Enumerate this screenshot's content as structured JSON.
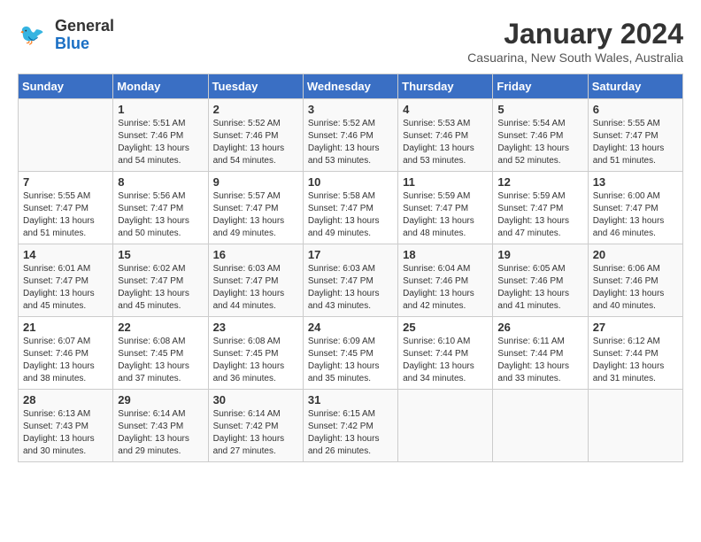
{
  "header": {
    "logo_line1": "General",
    "logo_line2": "Blue",
    "title": "January 2024",
    "subtitle": "Casuarina, New South Wales, Australia"
  },
  "weekdays": [
    "Sunday",
    "Monday",
    "Tuesday",
    "Wednesday",
    "Thursday",
    "Friday",
    "Saturday"
  ],
  "weeks": [
    [
      {
        "day": "",
        "info": ""
      },
      {
        "day": "1",
        "info": "Sunrise: 5:51 AM\nSunset: 7:46 PM\nDaylight: 13 hours\nand 54 minutes."
      },
      {
        "day": "2",
        "info": "Sunrise: 5:52 AM\nSunset: 7:46 PM\nDaylight: 13 hours\nand 54 minutes."
      },
      {
        "day": "3",
        "info": "Sunrise: 5:52 AM\nSunset: 7:46 PM\nDaylight: 13 hours\nand 53 minutes."
      },
      {
        "day": "4",
        "info": "Sunrise: 5:53 AM\nSunset: 7:46 PM\nDaylight: 13 hours\nand 53 minutes."
      },
      {
        "day": "5",
        "info": "Sunrise: 5:54 AM\nSunset: 7:46 PM\nDaylight: 13 hours\nand 52 minutes."
      },
      {
        "day": "6",
        "info": "Sunrise: 5:55 AM\nSunset: 7:47 PM\nDaylight: 13 hours\nand 51 minutes."
      }
    ],
    [
      {
        "day": "7",
        "info": "Sunrise: 5:55 AM\nSunset: 7:47 PM\nDaylight: 13 hours\nand 51 minutes."
      },
      {
        "day": "8",
        "info": "Sunrise: 5:56 AM\nSunset: 7:47 PM\nDaylight: 13 hours\nand 50 minutes."
      },
      {
        "day": "9",
        "info": "Sunrise: 5:57 AM\nSunset: 7:47 PM\nDaylight: 13 hours\nand 49 minutes."
      },
      {
        "day": "10",
        "info": "Sunrise: 5:58 AM\nSunset: 7:47 PM\nDaylight: 13 hours\nand 49 minutes."
      },
      {
        "day": "11",
        "info": "Sunrise: 5:59 AM\nSunset: 7:47 PM\nDaylight: 13 hours\nand 48 minutes."
      },
      {
        "day": "12",
        "info": "Sunrise: 5:59 AM\nSunset: 7:47 PM\nDaylight: 13 hours\nand 47 minutes."
      },
      {
        "day": "13",
        "info": "Sunrise: 6:00 AM\nSunset: 7:47 PM\nDaylight: 13 hours\nand 46 minutes."
      }
    ],
    [
      {
        "day": "14",
        "info": "Sunrise: 6:01 AM\nSunset: 7:47 PM\nDaylight: 13 hours\nand 45 minutes."
      },
      {
        "day": "15",
        "info": "Sunrise: 6:02 AM\nSunset: 7:47 PM\nDaylight: 13 hours\nand 45 minutes."
      },
      {
        "day": "16",
        "info": "Sunrise: 6:03 AM\nSunset: 7:47 PM\nDaylight: 13 hours\nand 44 minutes."
      },
      {
        "day": "17",
        "info": "Sunrise: 6:03 AM\nSunset: 7:47 PM\nDaylight: 13 hours\nand 43 minutes."
      },
      {
        "day": "18",
        "info": "Sunrise: 6:04 AM\nSunset: 7:46 PM\nDaylight: 13 hours\nand 42 minutes."
      },
      {
        "day": "19",
        "info": "Sunrise: 6:05 AM\nSunset: 7:46 PM\nDaylight: 13 hours\nand 41 minutes."
      },
      {
        "day": "20",
        "info": "Sunrise: 6:06 AM\nSunset: 7:46 PM\nDaylight: 13 hours\nand 40 minutes."
      }
    ],
    [
      {
        "day": "21",
        "info": "Sunrise: 6:07 AM\nSunset: 7:46 PM\nDaylight: 13 hours\nand 38 minutes."
      },
      {
        "day": "22",
        "info": "Sunrise: 6:08 AM\nSunset: 7:45 PM\nDaylight: 13 hours\nand 37 minutes."
      },
      {
        "day": "23",
        "info": "Sunrise: 6:08 AM\nSunset: 7:45 PM\nDaylight: 13 hours\nand 36 minutes."
      },
      {
        "day": "24",
        "info": "Sunrise: 6:09 AM\nSunset: 7:45 PM\nDaylight: 13 hours\nand 35 minutes."
      },
      {
        "day": "25",
        "info": "Sunrise: 6:10 AM\nSunset: 7:44 PM\nDaylight: 13 hours\nand 34 minutes."
      },
      {
        "day": "26",
        "info": "Sunrise: 6:11 AM\nSunset: 7:44 PM\nDaylight: 13 hours\nand 33 minutes."
      },
      {
        "day": "27",
        "info": "Sunrise: 6:12 AM\nSunset: 7:44 PM\nDaylight: 13 hours\nand 31 minutes."
      }
    ],
    [
      {
        "day": "28",
        "info": "Sunrise: 6:13 AM\nSunset: 7:43 PM\nDaylight: 13 hours\nand 30 minutes."
      },
      {
        "day": "29",
        "info": "Sunrise: 6:14 AM\nSunset: 7:43 PM\nDaylight: 13 hours\nand 29 minutes."
      },
      {
        "day": "30",
        "info": "Sunrise: 6:14 AM\nSunset: 7:42 PM\nDaylight: 13 hours\nand 27 minutes."
      },
      {
        "day": "31",
        "info": "Sunrise: 6:15 AM\nSunset: 7:42 PM\nDaylight: 13 hours\nand 26 minutes."
      },
      {
        "day": "",
        "info": ""
      },
      {
        "day": "",
        "info": ""
      },
      {
        "day": "",
        "info": ""
      }
    ]
  ]
}
